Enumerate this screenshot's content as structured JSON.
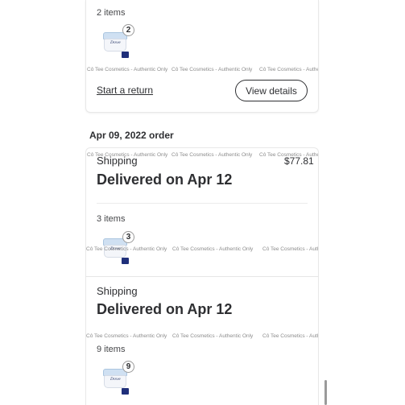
{
  "watermark_text": "Cô Tee Cosmetics - Authentic Only",
  "previous_order": {
    "items_label": "2 items",
    "item_qty": "2",
    "start_return_label": "Start a return",
    "view_details_label": "View details"
  },
  "order": {
    "date_heading": "Apr 09, 2022 order",
    "total_price": "$77.81",
    "shipments": [
      {
        "type_label": "Shipping",
        "status": "Delivered on Apr 12",
        "items_label": "3 items",
        "item_qty": "3"
      },
      {
        "type_label": "Shipping",
        "status": "Delivered on Apr 12",
        "items_label": "9 items",
        "item_qty": "9"
      }
    ]
  },
  "product_thumbnail": {
    "brand": "Dove",
    "icon": "product-jar-icon"
  },
  "colors": {
    "text": "#2e2f32",
    "border": "#e8e8e8",
    "watermark": "#8c8c8c"
  }
}
